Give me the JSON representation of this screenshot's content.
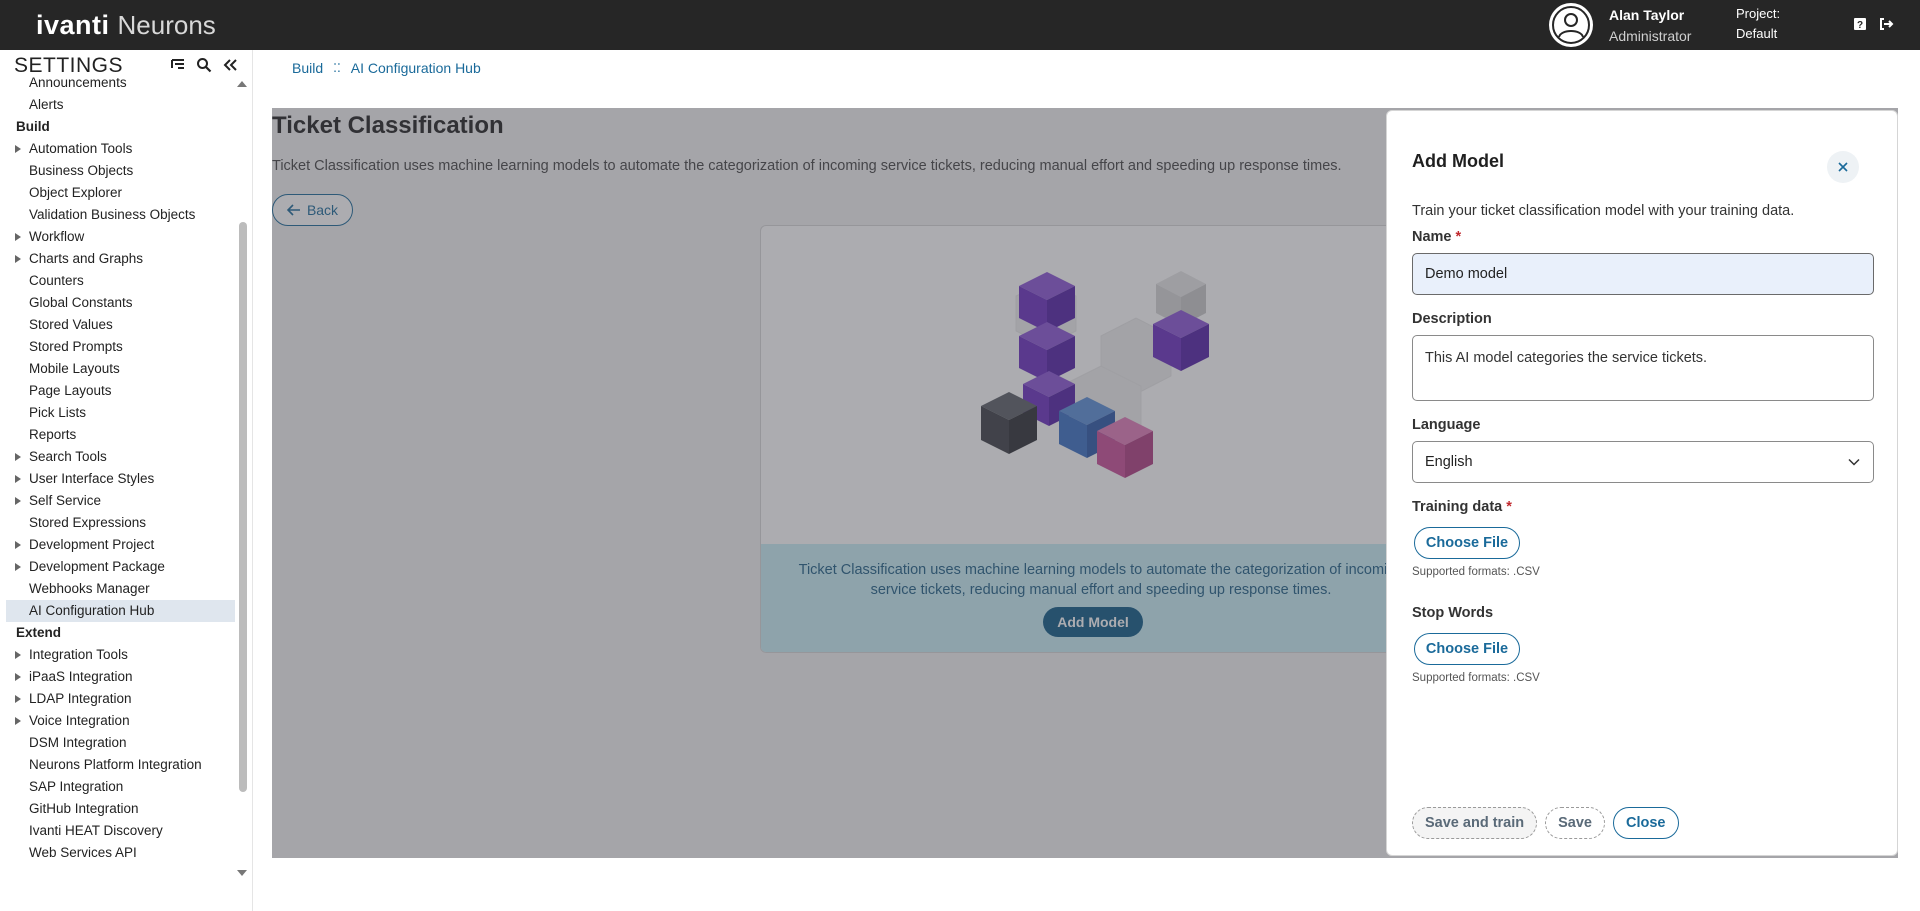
{
  "topbar": {
    "logo_main": "ivanti",
    "logo_sub": "Neurons",
    "user_name": "Alan Taylor",
    "user_role": "Administrator",
    "project_label": "Project:",
    "project_value": "Default"
  },
  "sidebar": {
    "title": "SETTINGS",
    "items": [
      {
        "label": "Announcements",
        "type": "item"
      },
      {
        "label": "Alerts",
        "type": "item"
      },
      {
        "label": "Build",
        "type": "section"
      },
      {
        "label": "Automation Tools",
        "type": "arrow"
      },
      {
        "label": "Business Objects",
        "type": "item"
      },
      {
        "label": "Object Explorer",
        "type": "item"
      },
      {
        "label": "Validation Business Objects",
        "type": "item"
      },
      {
        "label": "Workflow",
        "type": "arrow"
      },
      {
        "label": "Charts and Graphs",
        "type": "arrow"
      },
      {
        "label": "Counters",
        "type": "item"
      },
      {
        "label": "Global Constants",
        "type": "item"
      },
      {
        "label": "Stored Values",
        "type": "item"
      },
      {
        "label": "Stored Prompts",
        "type": "item"
      },
      {
        "label": "Mobile Layouts",
        "type": "item"
      },
      {
        "label": "Page Layouts",
        "type": "item"
      },
      {
        "label": "Pick Lists",
        "type": "item"
      },
      {
        "label": "Reports",
        "type": "item"
      },
      {
        "label": "Search Tools",
        "type": "arrow"
      },
      {
        "label": "User Interface Styles",
        "type": "arrow"
      },
      {
        "label": "Self Service",
        "type": "arrow"
      },
      {
        "label": "Stored Expressions",
        "type": "item"
      },
      {
        "label": "Development Project",
        "type": "arrow"
      },
      {
        "label": "Development Package",
        "type": "arrow"
      },
      {
        "label": "Webhooks Manager",
        "type": "item"
      },
      {
        "label": "AI Configuration Hub",
        "type": "active"
      },
      {
        "label": "Extend",
        "type": "section"
      },
      {
        "label": "Integration Tools",
        "type": "arrow"
      },
      {
        "label": "iPaaS Integration",
        "type": "arrow"
      },
      {
        "label": "LDAP Integration",
        "type": "arrow"
      },
      {
        "label": "Voice Integration",
        "type": "arrow"
      },
      {
        "label": "DSM Integration",
        "type": "item"
      },
      {
        "label": "Neurons Platform Integration",
        "type": "item"
      },
      {
        "label": "SAP Integration",
        "type": "item"
      },
      {
        "label": "GitHub Integration",
        "type": "item"
      },
      {
        "label": "Ivanti HEAT Discovery",
        "type": "item"
      },
      {
        "label": "Web Services API",
        "type": "item"
      }
    ]
  },
  "breadcrumb": {
    "parent": "Build",
    "current": "AI Configuration Hub"
  },
  "main": {
    "title": "Ticket Classification",
    "description": "Ticket Classification uses machine learning models to automate the categorization of incoming service tickets, reducing manual effort and speeding up response times.",
    "back_label": "Back",
    "card_text": "Ticket Classification uses machine learning models to automate the categorization of incoming service tickets, reducing manual effort and speeding up response times.",
    "card_button": "Add Model"
  },
  "dialog": {
    "title": "Add Model",
    "subtitle": "Train your ticket classification model with your training data.",
    "name_label": "Name",
    "name_value": "Demo model",
    "description_label": "Description",
    "description_value": "This AI model categories the service tickets.",
    "language_label": "Language",
    "language_value": "English",
    "training_label": "Training data",
    "training_button": "Choose File",
    "training_hint": "Supported formats: .CSV",
    "stopwords_label": "Stop Words",
    "stopwords_button": "Choose File",
    "stopwords_hint": "Supported formats: .CSV",
    "save_train_label": "Save and train",
    "save_label": "Save",
    "close_label": "Close",
    "required_mark": "*"
  },
  "colors": {
    "topbar": "#262626",
    "accent": "#1a6a9a",
    "primary_button": "#0e5a86",
    "required": "#c0282d"
  }
}
